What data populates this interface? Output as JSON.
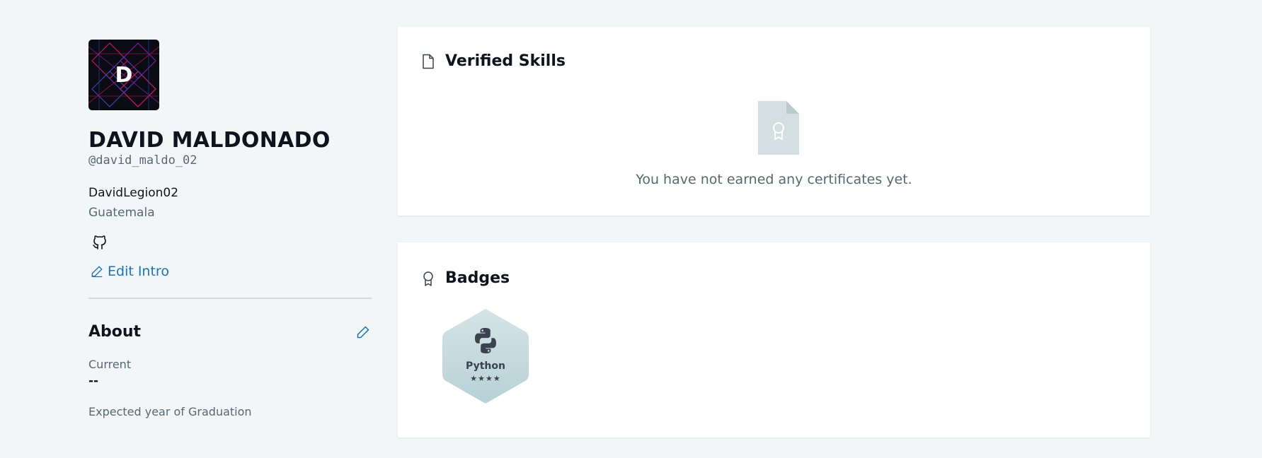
{
  "profile": {
    "avatar_letter": "D",
    "name": "DAVID MALDONADO",
    "handle": "@david_maldo_02",
    "username": "DavidLegion02",
    "country": "Guatemala",
    "edit_intro_label": "Edit Intro",
    "social_icon": "github-icon"
  },
  "about": {
    "title": "About",
    "fields": [
      {
        "label": "Current",
        "value": "--"
      },
      {
        "label": "Expected year of Graduation",
        "value": ""
      }
    ]
  },
  "verified_skills": {
    "title": "Verified Skills",
    "icon": "file-icon",
    "empty_message": "You have not earned any certificates yet."
  },
  "badges": {
    "title": "Badges",
    "icon": "award-icon",
    "items": [
      {
        "name": "Python",
        "stars_filled": 4,
        "stars_text": "★★★★"
      }
    ]
  },
  "colors": {
    "background": "#f3f6f7",
    "link": "#1a73b8",
    "badge_fill": "#c5dadd",
    "text_primary": "#0e141e",
    "text_secondary": "#576871"
  }
}
